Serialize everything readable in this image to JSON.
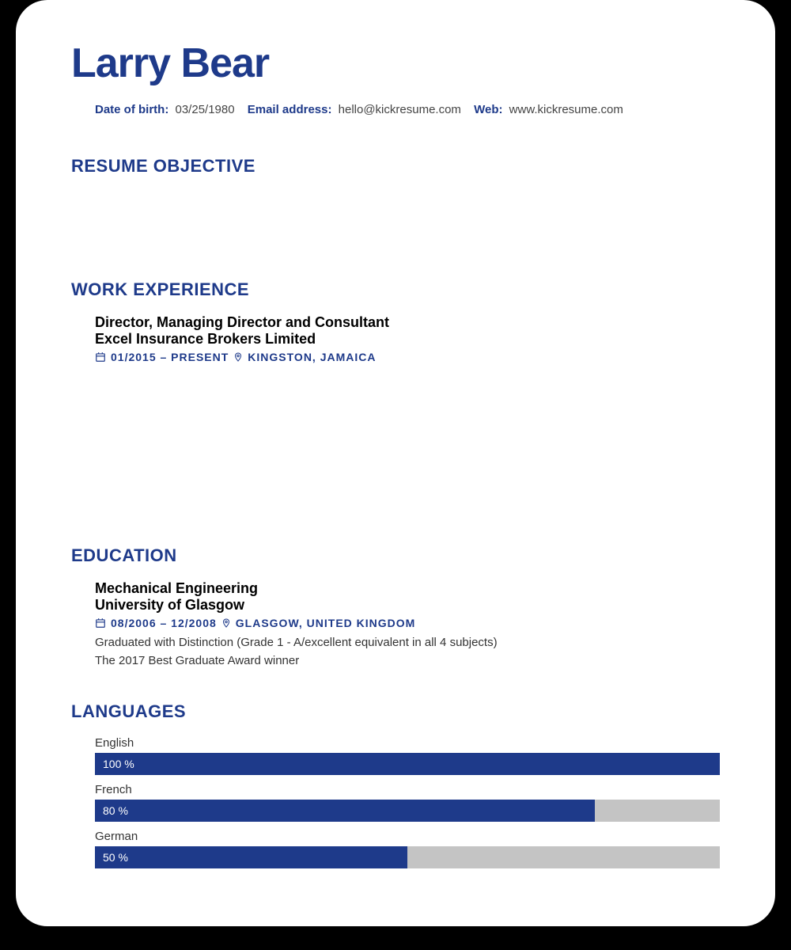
{
  "name": "Larry Bear",
  "contact": {
    "dob_label": "Date of birth:",
    "dob": "03/25/1980",
    "email_label": "Email address:",
    "email": "hello@kickresume.com",
    "web_label": "Web:",
    "web": "www.kickresume.com"
  },
  "sections": {
    "objective": "RESUME OBJECTIVE",
    "work": "WORK EXPERIENCE",
    "education": "EDUCATION",
    "languages": "LANGUAGES"
  },
  "work": {
    "title": "Director, Managing Director and Consultant",
    "company": "Excel Insurance Brokers Limited",
    "dates": "01/2015 – present",
    "location": "KINGSTON, JAMAICA"
  },
  "education": {
    "title": "Mechanical Engineering",
    "school": "University of Glasgow",
    "dates": "08/2006 – 12/2008",
    "location": "GLASGOW, UNITED KINGDOM",
    "desc1": "Graduated with Distinction (Grade 1 - A/excellent equivalent in all 4 subjects)",
    "desc2": "The 2017 Best Graduate Award winner"
  },
  "languages": [
    {
      "name": "English",
      "percent": 100,
      "label": "100 %"
    },
    {
      "name": "French",
      "percent": 80,
      "label": "80 %"
    },
    {
      "name": "German",
      "percent": 50,
      "label": "50 %"
    }
  ]
}
